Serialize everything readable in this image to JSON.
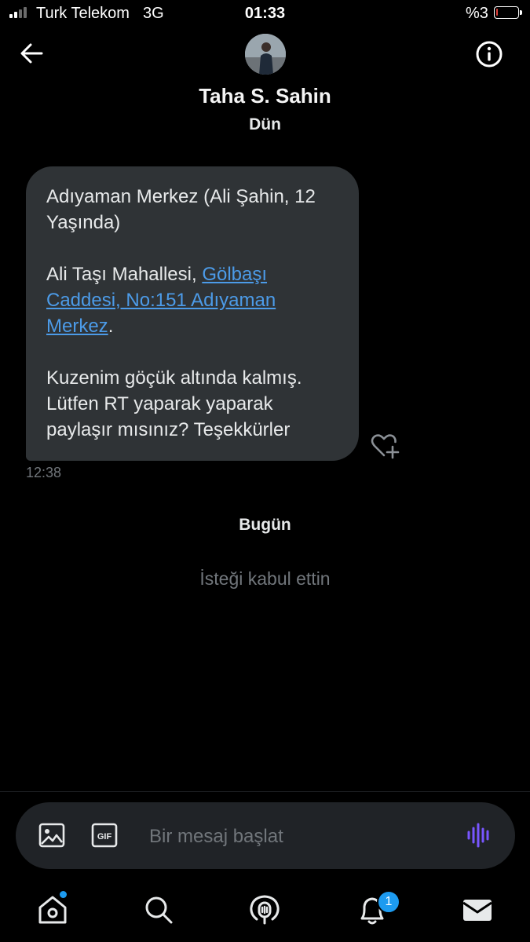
{
  "status_bar": {
    "carrier": "Turk Telekom",
    "network": "3G",
    "time": "01:33",
    "battery_percent": "%3",
    "battery_level": 0.03,
    "signal_bars": 2,
    "accent_low_battery": "#e0403a"
  },
  "header": {
    "back_icon": "arrow-left-icon",
    "contact_name": "Taha S. Sahin",
    "info_icon": "info-icon"
  },
  "conversation": {
    "day_label_1": "Dün",
    "message": {
      "line_1": "Adıyaman Merkez (Ali Şahin, 12 Yaşında)",
      "address_prefix": "Ali Taşı Mahallesi, ",
      "address_link": "Gölbaşı Caddesi, No:151 Adıyaman Merkez",
      "address_suffix": ".",
      "line_3": "Kuzenim göçük altında kalmış. Lütfen RT yaparak yaparak paylaşır mısınız? Teşekkürler",
      "time": "12:38"
    },
    "day_label_2": "Bugün",
    "system_note": "İsteği kabul ettin"
  },
  "composer": {
    "placeholder": "Bir mesaj başlat",
    "image_icon": "image-icon",
    "gif_label": "GIF",
    "voice_icon": "voice-wave-icon",
    "voice_color": "#7856ff"
  },
  "bottom_nav": {
    "items": [
      "home-icon",
      "search-icon",
      "spaces-icon",
      "notifications-icon",
      "messages-icon"
    ],
    "notifications_count": "1",
    "accent": "#1d9bf0"
  }
}
